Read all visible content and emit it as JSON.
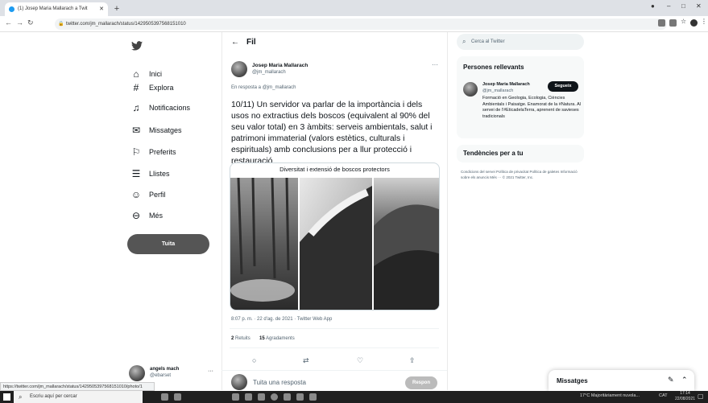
{
  "browser": {
    "tab_title": "(1) Josep Maria Mallarach a Twit",
    "new_tab": "+",
    "url": "twitter.com/jm_mallarach/status/1429505397568151010",
    "back_icon": "arrow-left-icon",
    "forward_icon": "arrow-right-icon",
    "reload_icon": "reload-icon",
    "status_url": "https://twitter.com/jm_mallarach/status/1429505397568151010/photo/1"
  },
  "sidebar": {
    "items": [
      {
        "label": "Inici",
        "icon": "home-icon"
      },
      {
        "label": "Explora",
        "icon": "hashtag-icon"
      },
      {
        "label": "Notificacions",
        "icon": "bell-icon"
      },
      {
        "label": "Missatges",
        "icon": "envelope-icon"
      },
      {
        "label": "Preferits",
        "icon": "bookmark-icon"
      },
      {
        "label": "Llistes",
        "icon": "list-icon"
      },
      {
        "label": "Perfil",
        "icon": "person-icon"
      },
      {
        "label": "Més",
        "icon": "more-circle-icon"
      }
    ],
    "tweet_button": "Tuita",
    "account": {
      "name": "angels mach",
      "handle": "@ebarset",
      "more": "···"
    }
  },
  "main": {
    "header_title": "Fil",
    "author_name": "Josep Maria Mallarach",
    "author_handle": "@jm_mallarach",
    "more": "···",
    "reply_to": "En resposta a @jm_mallarach",
    "text": "10/11) Un servidor va parlar de la importància i dels usos no extractius dels boscos (equivalent al 90% del seu valor total) en 3 àmbits: serveis ambientals, salut i patrimoni immaterial (valors estètics, culturals i espirituals) amb conclusions per a llur protecció i restauració",
    "image_caption": "Diversitat i extensió de boscos protectors",
    "timestamp": "8:07 p. m. · 22 d'ag. de 2021 · Twitter Web App",
    "retweets_count": "2",
    "retweets_label": "Retuits",
    "likes_count": "15",
    "likes_label": "Agradaments",
    "reply_placeholder": "Tuita una resposta",
    "reply_button": "Respon"
  },
  "right": {
    "search_placeholder": "Cerca al Twitter",
    "relevant_title": "Persones rellevants",
    "person_name": "Josep Maria Mallarach",
    "person_handle": "@jm_mallarach",
    "follow_button": "Segueix",
    "person_bio": "Formació en Geologia, Ecologia, Ciències Ambientals i Paisatge. Enamorat de la #Natura. Al servei de l'#EticadelaTerra, aprenent de savieses tradicionals",
    "trends_title": "Tendències per a tu",
    "footer": "Condicions del servei  Política de privacitat  Política de galetes  Informació sobre els anuncis  Més ···  © 2021 Twitter, Inc.",
    "messages_title": "Missatges"
  },
  "taskbar": {
    "search_placeholder": "Escriu aquí per cercar",
    "tray_text": "17°C Majoritàriament nuvola...",
    "lang": "CAT",
    "time": "17:14",
    "date": "22/08/2021"
  }
}
